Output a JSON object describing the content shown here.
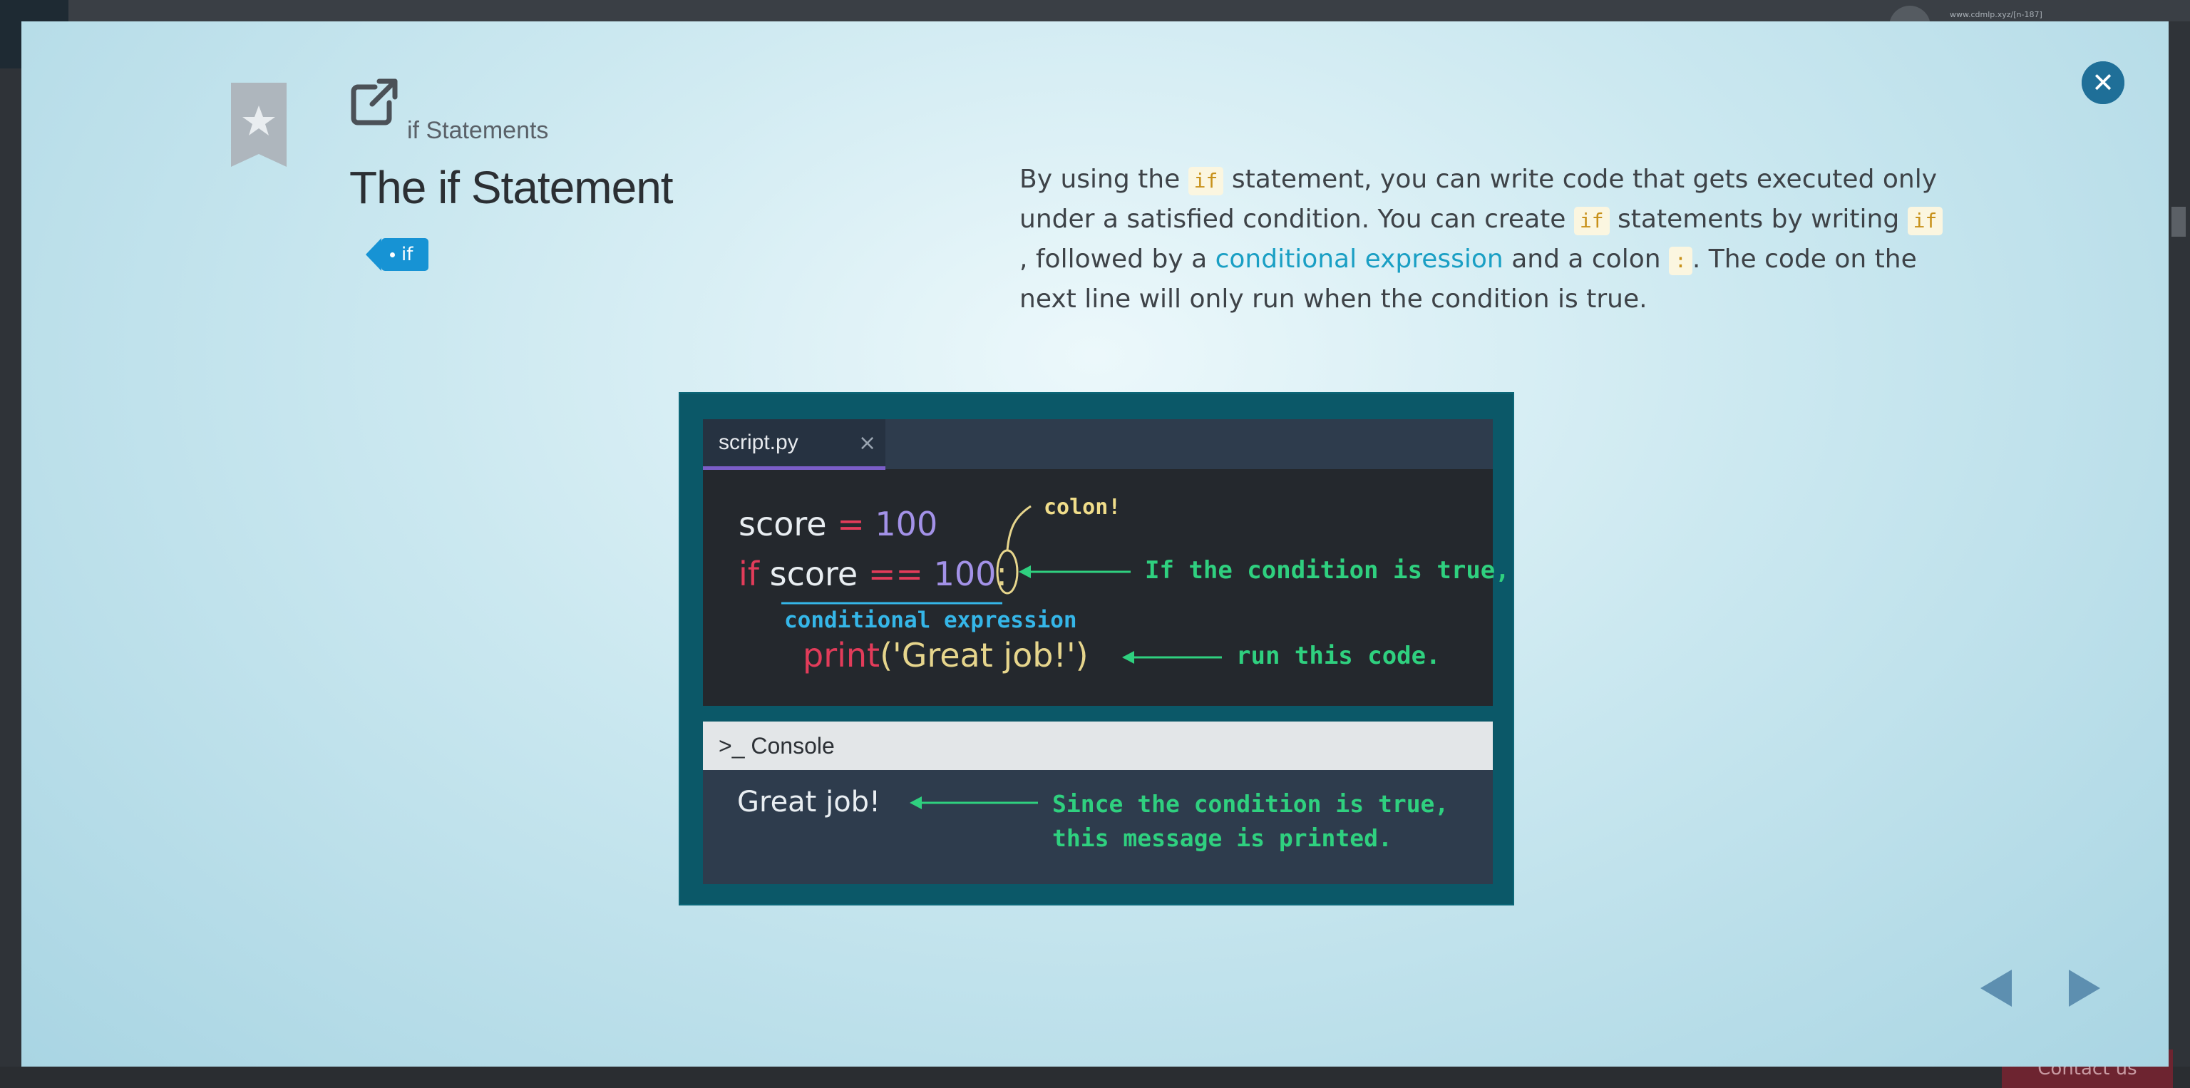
{
  "background": {
    "url_text": "www.cdmlp.xyz/[n-187]",
    "contact_label": "Contact us"
  },
  "modal": {
    "breadcrumb": "if Statements",
    "title": "The if Statement",
    "tag": "if",
    "description": {
      "p1": "By using the ",
      "code1": "if",
      "p2": " statement, you can write code that gets executed only under a satisfied condition. You can create ",
      "code2": "if",
      "p3": " statements by writing ",
      "code3": "if",
      "p4": ", followed by a ",
      "link": "conditional expression",
      "p5": " and a colon ",
      "code4": ":",
      "p6": ". The code on the next line will only run when the condition is true."
    },
    "figure": {
      "tab_label": "script.py",
      "tab_close": "×",
      "code": {
        "line1_var": "score",
        "line1_op": " = ",
        "line1_val": "100",
        "line2_kw": "if",
        "line2_var": "score",
        "line2_op": " == ",
        "line2_val": "100",
        "line2_colon": ":",
        "line3_fn": "print",
        "line3_open": "(",
        "line3_str": "'Great job!'",
        "line3_close": ")"
      },
      "annotations": {
        "colon": "colon!",
        "condition_true": "If the condition is true,",
        "cond_expr": "conditional expression",
        "run_code": "run this code.",
        "printed_1": "Since the condition is true,",
        "printed_2": "this message is printed."
      },
      "console_label": "Console",
      "console_output": "Great job!"
    }
  },
  "colors": {
    "accent": "#1793d4",
    "close": "#1f6f98",
    "link": "#1a9fc4",
    "annotation_green": "#2fd07f"
  }
}
